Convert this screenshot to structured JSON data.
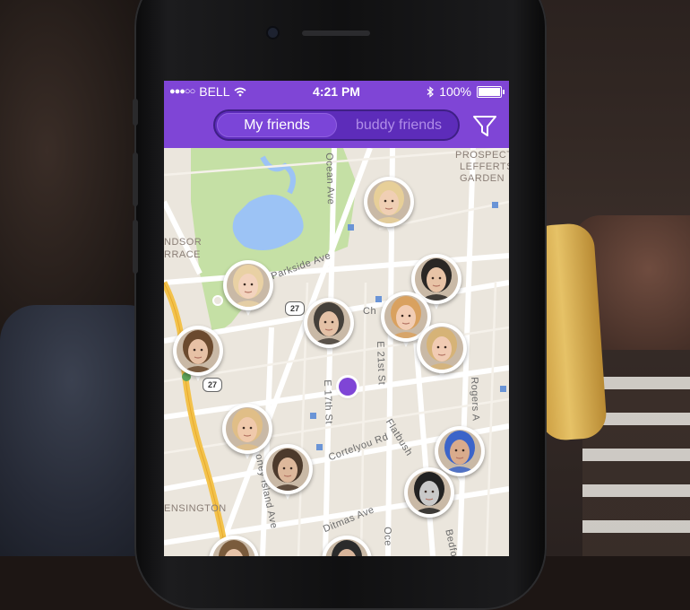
{
  "statusbar": {
    "carrier": "BELL",
    "signal_dots": "●●●○○",
    "time": "4:21 PM",
    "battery": "100%"
  },
  "tabs": {
    "active": "My friends",
    "inactive": "buddy friends"
  },
  "colors": {
    "accent": "#7f45d6",
    "accent_dark": "#5d2cba",
    "park": "#c5e0a5",
    "water": "#9cc3f5",
    "road": "#ffffff",
    "highway": "#f3c24b"
  },
  "map": {
    "labels": {
      "ocean_ave": "Ocean Ave",
      "prospect_lefferts": "PROSPECT",
      "prospect_lefferts2": "LEFFERTS",
      "prospect_lefferts3": "GARDEN",
      "windsor": "NDSOR",
      "windsor2": "RRACE",
      "parkside": "Parkside Ave",
      "church": "Ch",
      "e21": "E 21st St",
      "e17": "E 17th St",
      "rogers": "Rogers A",
      "cortelyou": "Cortelyou Rd",
      "flatbush": "Flatbush",
      "coney": "oney Island Ave",
      "ditmas": "Ditmas Ave",
      "kensington": "ENSINGTON",
      "ocean2": "Oce",
      "bedford": "Bedfo",
      "route_27a": "27",
      "route_27b": "27"
    }
  },
  "friends": [
    {
      "name": "friend-blonde-top",
      "skin": "#f0cfb4",
      "hair": "#e7cf98"
    },
    {
      "name": "friend-blonde-park",
      "skin": "#f3d3be",
      "hair": "#e9d1a4"
    },
    {
      "name": "friend-beard-right",
      "skin": "#e8c3a6",
      "hair": "#2a2725"
    },
    {
      "name": "friend-glasses",
      "skin": "#e4c1a6",
      "hair": "#45403a"
    },
    {
      "name": "friend-redhead",
      "skin": "#f2cdb4",
      "hair": "#d9a15f"
    },
    {
      "name": "friend-smile-right",
      "skin": "#f1cbb3",
      "hair": "#d6b377"
    },
    {
      "name": "friend-boy-left",
      "skin": "#e7c1a5",
      "hair": "#6b4a2e"
    },
    {
      "name": "friend-blonde-mid",
      "skin": "#f0c9ab",
      "hair": "#e0be87"
    },
    {
      "name": "friend-hipster",
      "skin": "#ddb89b",
      "hair": "#4c3a2c"
    },
    {
      "name": "friend-bluehair",
      "skin": "#d9ab8c",
      "hair": "#3b64c9"
    },
    {
      "name": "friend-bw",
      "skin": "#c9c9c9",
      "hair": "#222222"
    },
    {
      "name": "friend-bottom-1",
      "skin": "#e6c3a8",
      "hair": "#7a5b3c"
    },
    {
      "name": "friend-bottom-2",
      "skin": "#d7b49a",
      "hair": "#2b2b2b"
    }
  ]
}
